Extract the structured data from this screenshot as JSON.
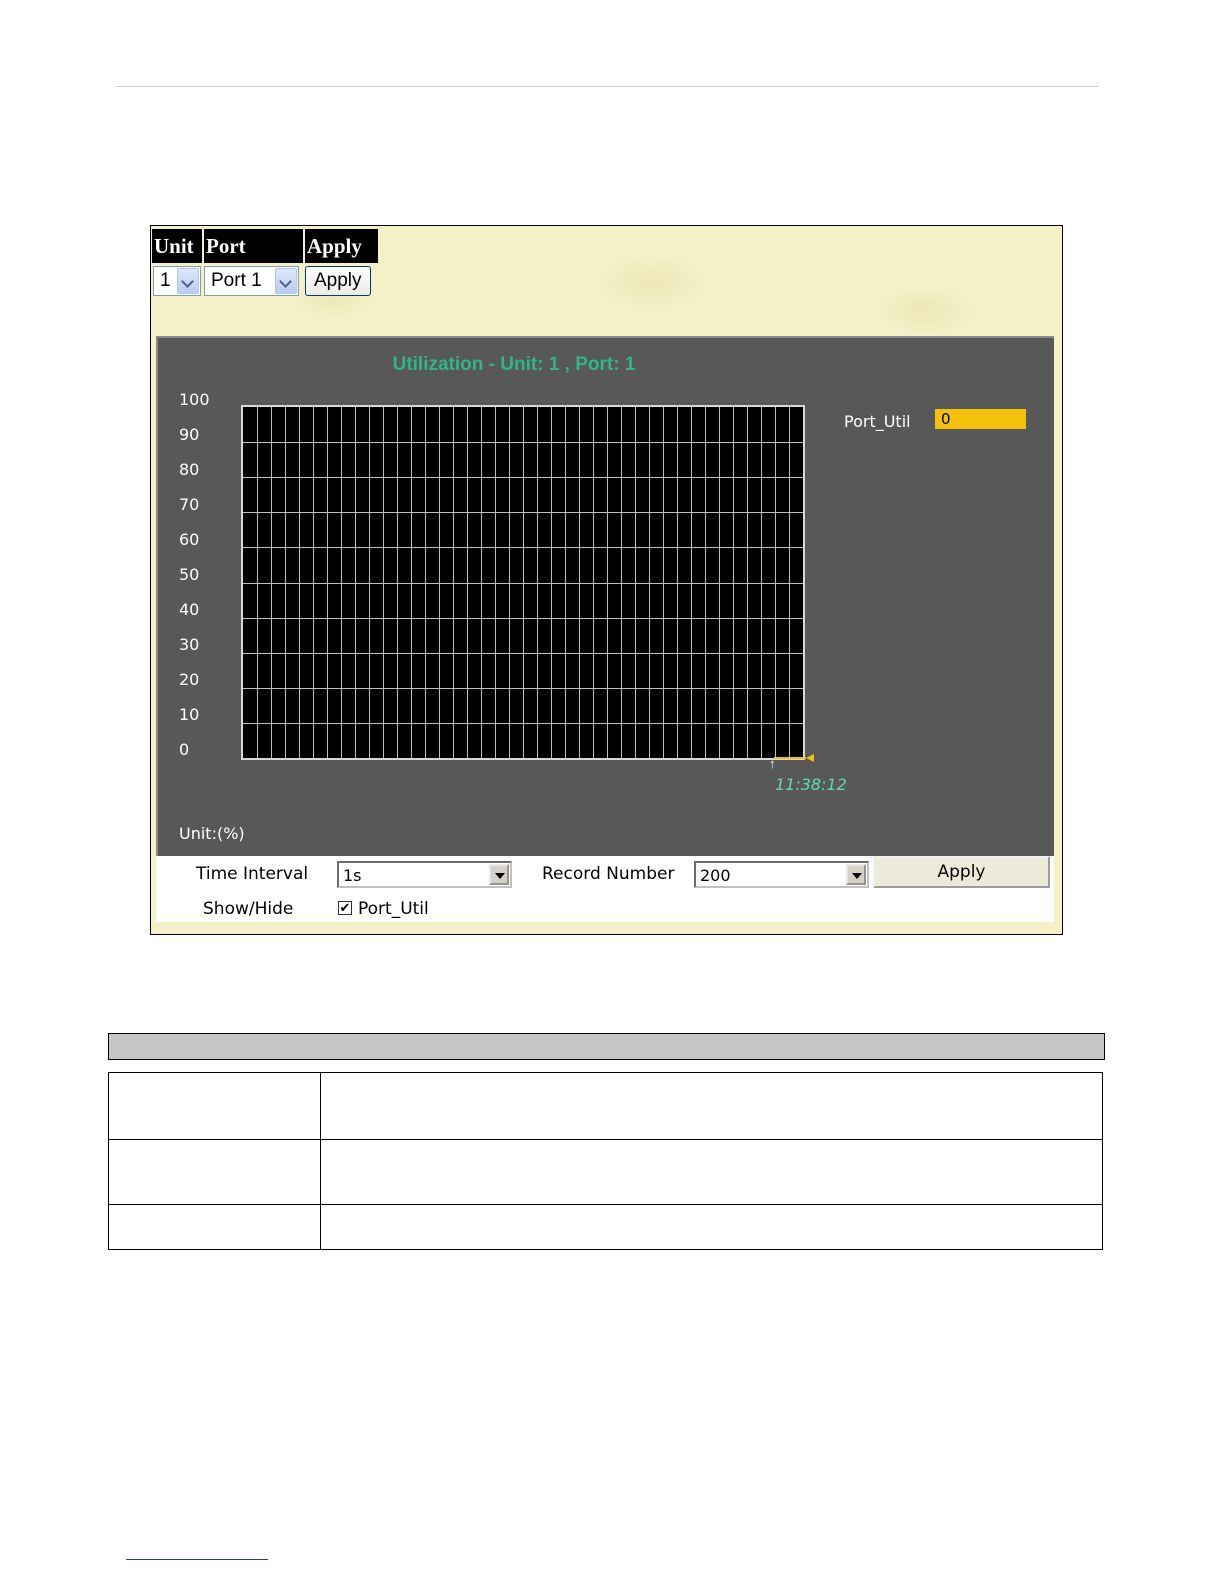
{
  "selector": {
    "headers": {
      "unit": "Unit",
      "port": "Port",
      "apply": "Apply"
    },
    "unit_value": "1",
    "port_value": "Port 1",
    "apply_label": "Apply"
  },
  "graph": {
    "title": "Utilization - Unit: 1 , Port: 1",
    "y_ticks": [
      "100",
      "90",
      "80",
      "70",
      "60",
      "50",
      "40",
      "30",
      "20",
      "10",
      "0"
    ],
    "legend_label": "Port_Util",
    "legend_value": "0",
    "time_label": "11:38:12",
    "unit_label": "Unit:(%)"
  },
  "controls": {
    "time_interval_label": "Time Interval",
    "time_interval_value": "1s",
    "record_number_label": "Record Number",
    "record_number_value": "200",
    "apply_label": "Apply",
    "show_hide_label": "Show/Hide",
    "port_util_label": "Port_Util",
    "port_util_checked": "✔"
  },
  "colors": {
    "title": "#2fb58a",
    "legend": "#f4c20d",
    "panel": "#585858",
    "background": "#f4f0c8"
  },
  "chart_data": {
    "type": "line",
    "ylim": [
      0,
      100
    ],
    "series": [
      {
        "name": "Port_Util",
        "values": [
          0
        ]
      }
    ]
  }
}
